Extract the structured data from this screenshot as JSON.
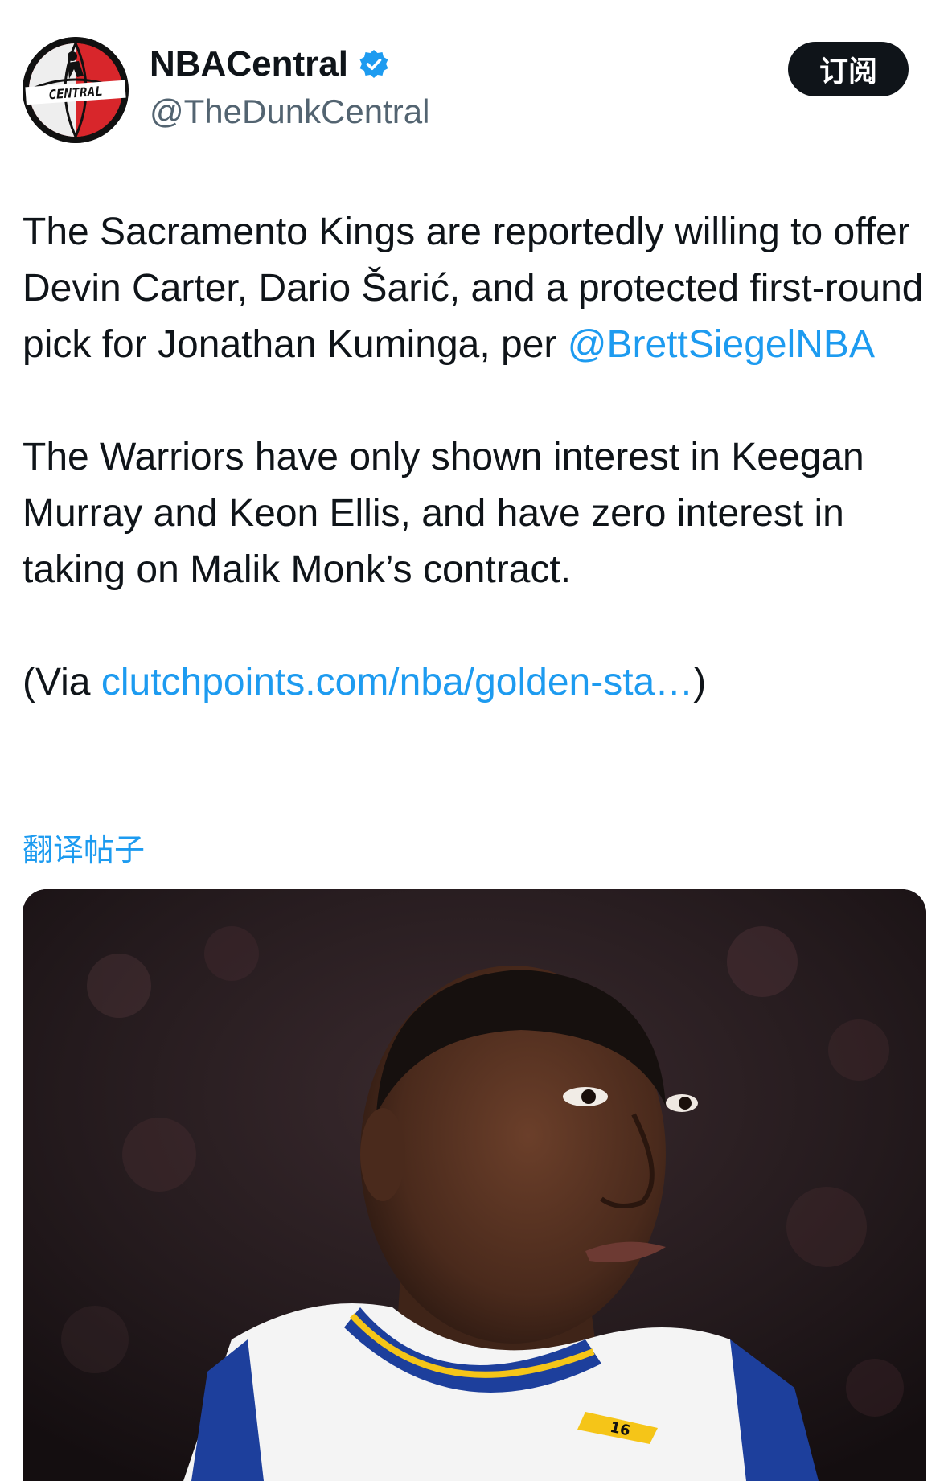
{
  "account": {
    "display_name": "NBACentral",
    "handle": "@TheDunkCentral",
    "avatar_text": "CENTRAL",
    "verified": true
  },
  "actions": {
    "subscribe_label": "订阅",
    "translate_label": "翻译帖子"
  },
  "tweet": {
    "p1_text": "The Sacramento Kings are reportedly willing to offer Devin Carter, Dario Šarić, and a protected first-round pick for Jonathan Kuminga, per",
    "p1_mention": "@BrettSiegelNBA",
    "p2_text": "The Warriors have only shown interest in Keegan Murray and Keon Ellis, and have zero interest in taking on Malik Monk’s contract.",
    "p3_prefix": "(Via ",
    "p3_link": "clutchpoints.com/nba/golden-sta…",
    "p3_suffix": ")"
  },
  "media": {
    "jersey_number": "16"
  },
  "colors": {
    "link": "#1d9bf0",
    "text": "#0f1419",
    "secondary": "#536471",
    "verified": "#1d9bf0",
    "button_bg": "#0f1419"
  }
}
